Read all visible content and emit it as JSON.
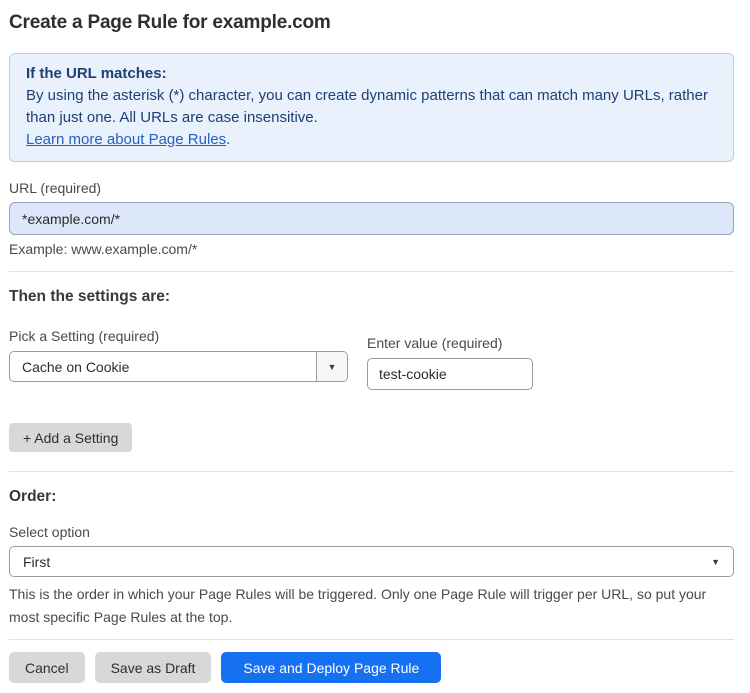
{
  "page": {
    "title": "Create a Page Rule for example.com"
  },
  "info_box": {
    "heading": "If the URL matches:",
    "body": "By using the asterisk (*) character, you can create dynamic patterns that can match many URLs, rather than just one. All URLs are case insensitive.",
    "link_label": "Learn more about Page Rules",
    "link_suffix": "."
  },
  "url_field": {
    "label": "URL (required)",
    "value": "*example.com/*",
    "helper": "Example: www.example.com/*"
  },
  "settings_section": {
    "heading": "Then the settings are:",
    "setting_label": "Pick a Setting (required)",
    "setting_value": "Cache on Cookie",
    "value_label": "Enter value (required)",
    "value_value": "test-cookie",
    "add_setting_label": "+ Add a Setting"
  },
  "order_section": {
    "heading": "Order:",
    "select_label": "Select option",
    "select_value": "First",
    "helper": "This is the order in which your Page Rules will be triggered. Only one Page Rule will trigger per URL, so put your most specific Page Rules at the top."
  },
  "footer": {
    "cancel_label": "Cancel",
    "save_draft_label": "Save as Draft",
    "save_deploy_label": "Save and Deploy Page Rule"
  },
  "icons": {
    "dropdown_arrow": "▼",
    "chevron_down": "▼"
  },
  "colors": {
    "info_box_bg": "#e9f2fc",
    "info_box_border": "#b2cfef",
    "info_text": "#1e3e74",
    "link": "#2660c1",
    "url_input_bg": "#dce8f9",
    "primary_button_bg": "#1670f2",
    "secondary_button_bg": "#d8d8d8"
  }
}
